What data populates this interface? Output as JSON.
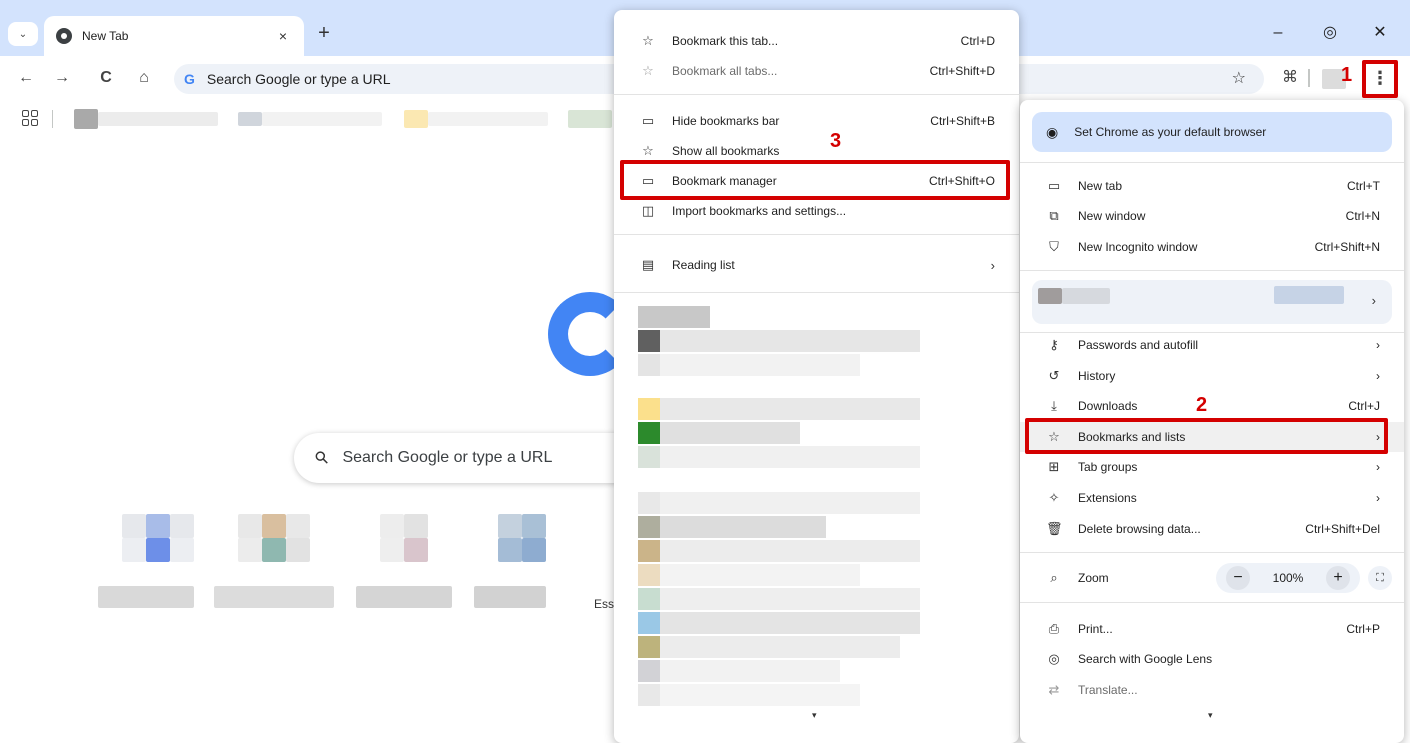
{
  "browser": {
    "tab_title": "New Tab",
    "tab_close": "×",
    "new_tab": "+",
    "tab_search": "⌄",
    "minimize": "–",
    "restore": "◎",
    "close": "✕",
    "omnibox_placeholder": "Search Google or type a URL",
    "omnibox_g": "G",
    "nav": {
      "back": "←",
      "forward": "→",
      "reload": "C",
      "home": "⌂"
    },
    "extensions_icon": "puzzle-icon",
    "menu_icon": "⋮"
  },
  "ntp": {
    "search_placeholder": "Search Google or type a URL",
    "shortcut_partial": "Ess"
  },
  "bookmarks_submenu": {
    "items": [
      {
        "icon": "☆",
        "label": "Bookmark this tab...",
        "shortcut": "Ctrl+D",
        "dim": false
      },
      {
        "icon": "☆",
        "label": "Bookmark all tabs...",
        "shortcut": "Ctrl+Shift+D",
        "dim": true
      },
      {
        "icon": "▭",
        "label": "Hide bookmarks bar",
        "shortcut": "Ctrl+Shift+B",
        "dim": false
      },
      {
        "icon": "☆",
        "label": "Show all bookmarks",
        "shortcut": "",
        "dim": false
      },
      {
        "icon": "▭",
        "label": "Bookmark manager",
        "shortcut": "Ctrl+Shift+O",
        "dim": false
      },
      {
        "icon": "◫",
        "label": "Import bookmarks and settings...",
        "shortcut": "",
        "dim": false
      },
      {
        "icon": "▤",
        "label": "Reading list",
        "shortcut": "",
        "dim": false
      }
    ],
    "reading_list_chevron": "›",
    "scroll_down": "▾"
  },
  "chrome_menu": {
    "default_browser": "Set Chrome as your default browser",
    "items": [
      {
        "icon": "▭",
        "label": "New tab",
        "shortcut": "Ctrl+T"
      },
      {
        "icon": "⧉",
        "label": "New window",
        "shortcut": "Ctrl+N"
      },
      {
        "icon": "⛉",
        "label": "New Incognito window",
        "shortcut": "Ctrl+Shift+N"
      },
      {
        "icon": "⚷",
        "label": "Passwords and autofill",
        "shortcut": "›"
      },
      {
        "icon": "↺",
        "label": "History",
        "shortcut": "›"
      },
      {
        "icon": "⤓",
        "label": "Downloads",
        "shortcut": "Ctrl+J"
      },
      {
        "icon": "☆",
        "label": "Bookmarks and lists",
        "shortcut": "›"
      },
      {
        "icon": "⊞",
        "label": "Tab groups",
        "shortcut": "›"
      },
      {
        "icon": "✧",
        "label": "Extensions",
        "shortcut": "›"
      },
      {
        "icon": "🗑",
        "label": "Delete browsing data...",
        "shortcut": "Ctrl+Shift+Del"
      },
      {
        "icon": "⎙",
        "label": "Print...",
        "shortcut": "Ctrl+P"
      },
      {
        "icon": "◎",
        "label": "Search with Google Lens",
        "shortcut": ""
      },
      {
        "icon": "⇄",
        "label": "Translate...",
        "shortcut": ""
      }
    ],
    "profile_chevron": "›",
    "zoom": {
      "label": "Zoom",
      "value": "100%",
      "minus": "−",
      "plus": "+",
      "fullscreen": "⛶",
      "icon": "⌕"
    },
    "scroll_down": "▾"
  },
  "annotations": {
    "step1": "1",
    "step2": "2",
    "step3": "3",
    "highlight_color": "#d40000"
  },
  "colors": {
    "tabstrip": "#d3e3fd",
    "accent_blue": "#4285f4"
  }
}
